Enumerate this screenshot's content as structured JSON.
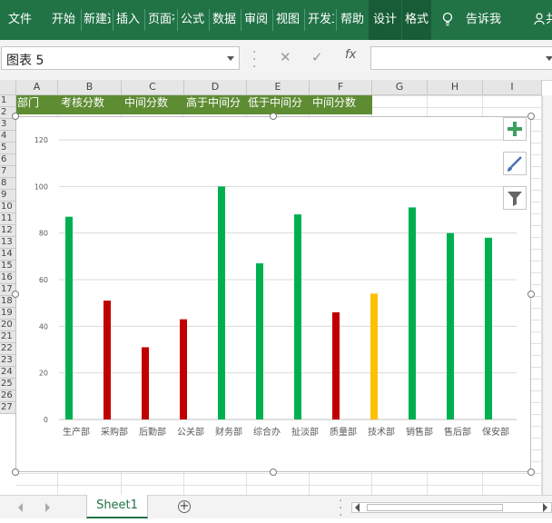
{
  "ribbon": {
    "tabs": [
      {
        "id": "file",
        "label": "文件"
      },
      {
        "id": "home",
        "label": "开始"
      },
      {
        "id": "new",
        "label": "新建选项卡"
      },
      {
        "id": "insert",
        "label": "插入"
      },
      {
        "id": "layout",
        "label": "页面布局"
      },
      {
        "id": "formulas",
        "label": "公式"
      },
      {
        "id": "data",
        "label": "数据"
      },
      {
        "id": "review",
        "label": "审阅"
      },
      {
        "id": "view",
        "label": "视图"
      },
      {
        "id": "developer",
        "label": "开发工具"
      },
      {
        "id": "help",
        "label": "帮助"
      },
      {
        "id": "design",
        "label": "设计"
      },
      {
        "id": "format",
        "label": "格式"
      }
    ],
    "tell_me": "告诉我",
    "share": "共享"
  },
  "formula_bar": {
    "name_box": "图表 5",
    "fx": "fx"
  },
  "columns": [
    "A",
    "B",
    "C",
    "D",
    "E",
    "F",
    "G",
    "H",
    "I"
  ],
  "rows": [
    "1",
    "2",
    "3",
    "4",
    "5",
    "6",
    "7",
    "8",
    "9",
    "10",
    "11",
    "12",
    "13",
    "14",
    "15",
    "16",
    "17",
    "18",
    "19",
    "20",
    "21",
    "22",
    "23",
    "24",
    "25",
    "26",
    "27"
  ],
  "header_cells": [
    "部门",
    "考核分数",
    "中间分数",
    "高于中间分",
    "低于中间分",
    "中间分数"
  ],
  "chart_data": {
    "type": "bar",
    "title": "",
    "xlabel": "",
    "ylabel": "",
    "categories": [
      "生产部",
      "采购部",
      "后勤部",
      "公关部",
      "财务部",
      "综合办",
      "扯淡部",
      "质量部",
      "技术部",
      "销售部",
      "售后部",
      "保安部"
    ],
    "series": [
      {
        "name": "高于中间分",
        "color": "#00b050",
        "values": [
          87,
          null,
          null,
          null,
          100,
          67,
          88,
          null,
          null,
          91,
          80,
          78
        ]
      },
      {
        "name": "低于中间分",
        "color": "#c00000",
        "values": [
          null,
          51,
          31,
          43,
          null,
          null,
          null,
          46,
          null,
          null,
          null,
          null
        ]
      },
      {
        "name": "中间分数",
        "color": "#ffc000",
        "values": [
          null,
          null,
          null,
          null,
          null,
          null,
          null,
          null,
          54,
          null,
          null,
          null
        ]
      }
    ],
    "ylim": [
      0,
      120
    ],
    "yticks": [
      "0",
      "20",
      "40",
      "60",
      "80",
      "100",
      "120"
    ],
    "grid": true,
    "legend": "none"
  },
  "chart_buttons": [
    {
      "name": "chart-elements-icon"
    },
    {
      "name": "chart-styles-icon"
    },
    {
      "name": "chart-filters-icon"
    }
  ],
  "sheet_tabs": {
    "active": "Sheet1",
    "add": "+"
  },
  "colors": {
    "ribbon": "#217346",
    "header_fill": "#5e8c33",
    "above": "#00b050",
    "below": "#c00000",
    "middle": "#ffc000"
  }
}
